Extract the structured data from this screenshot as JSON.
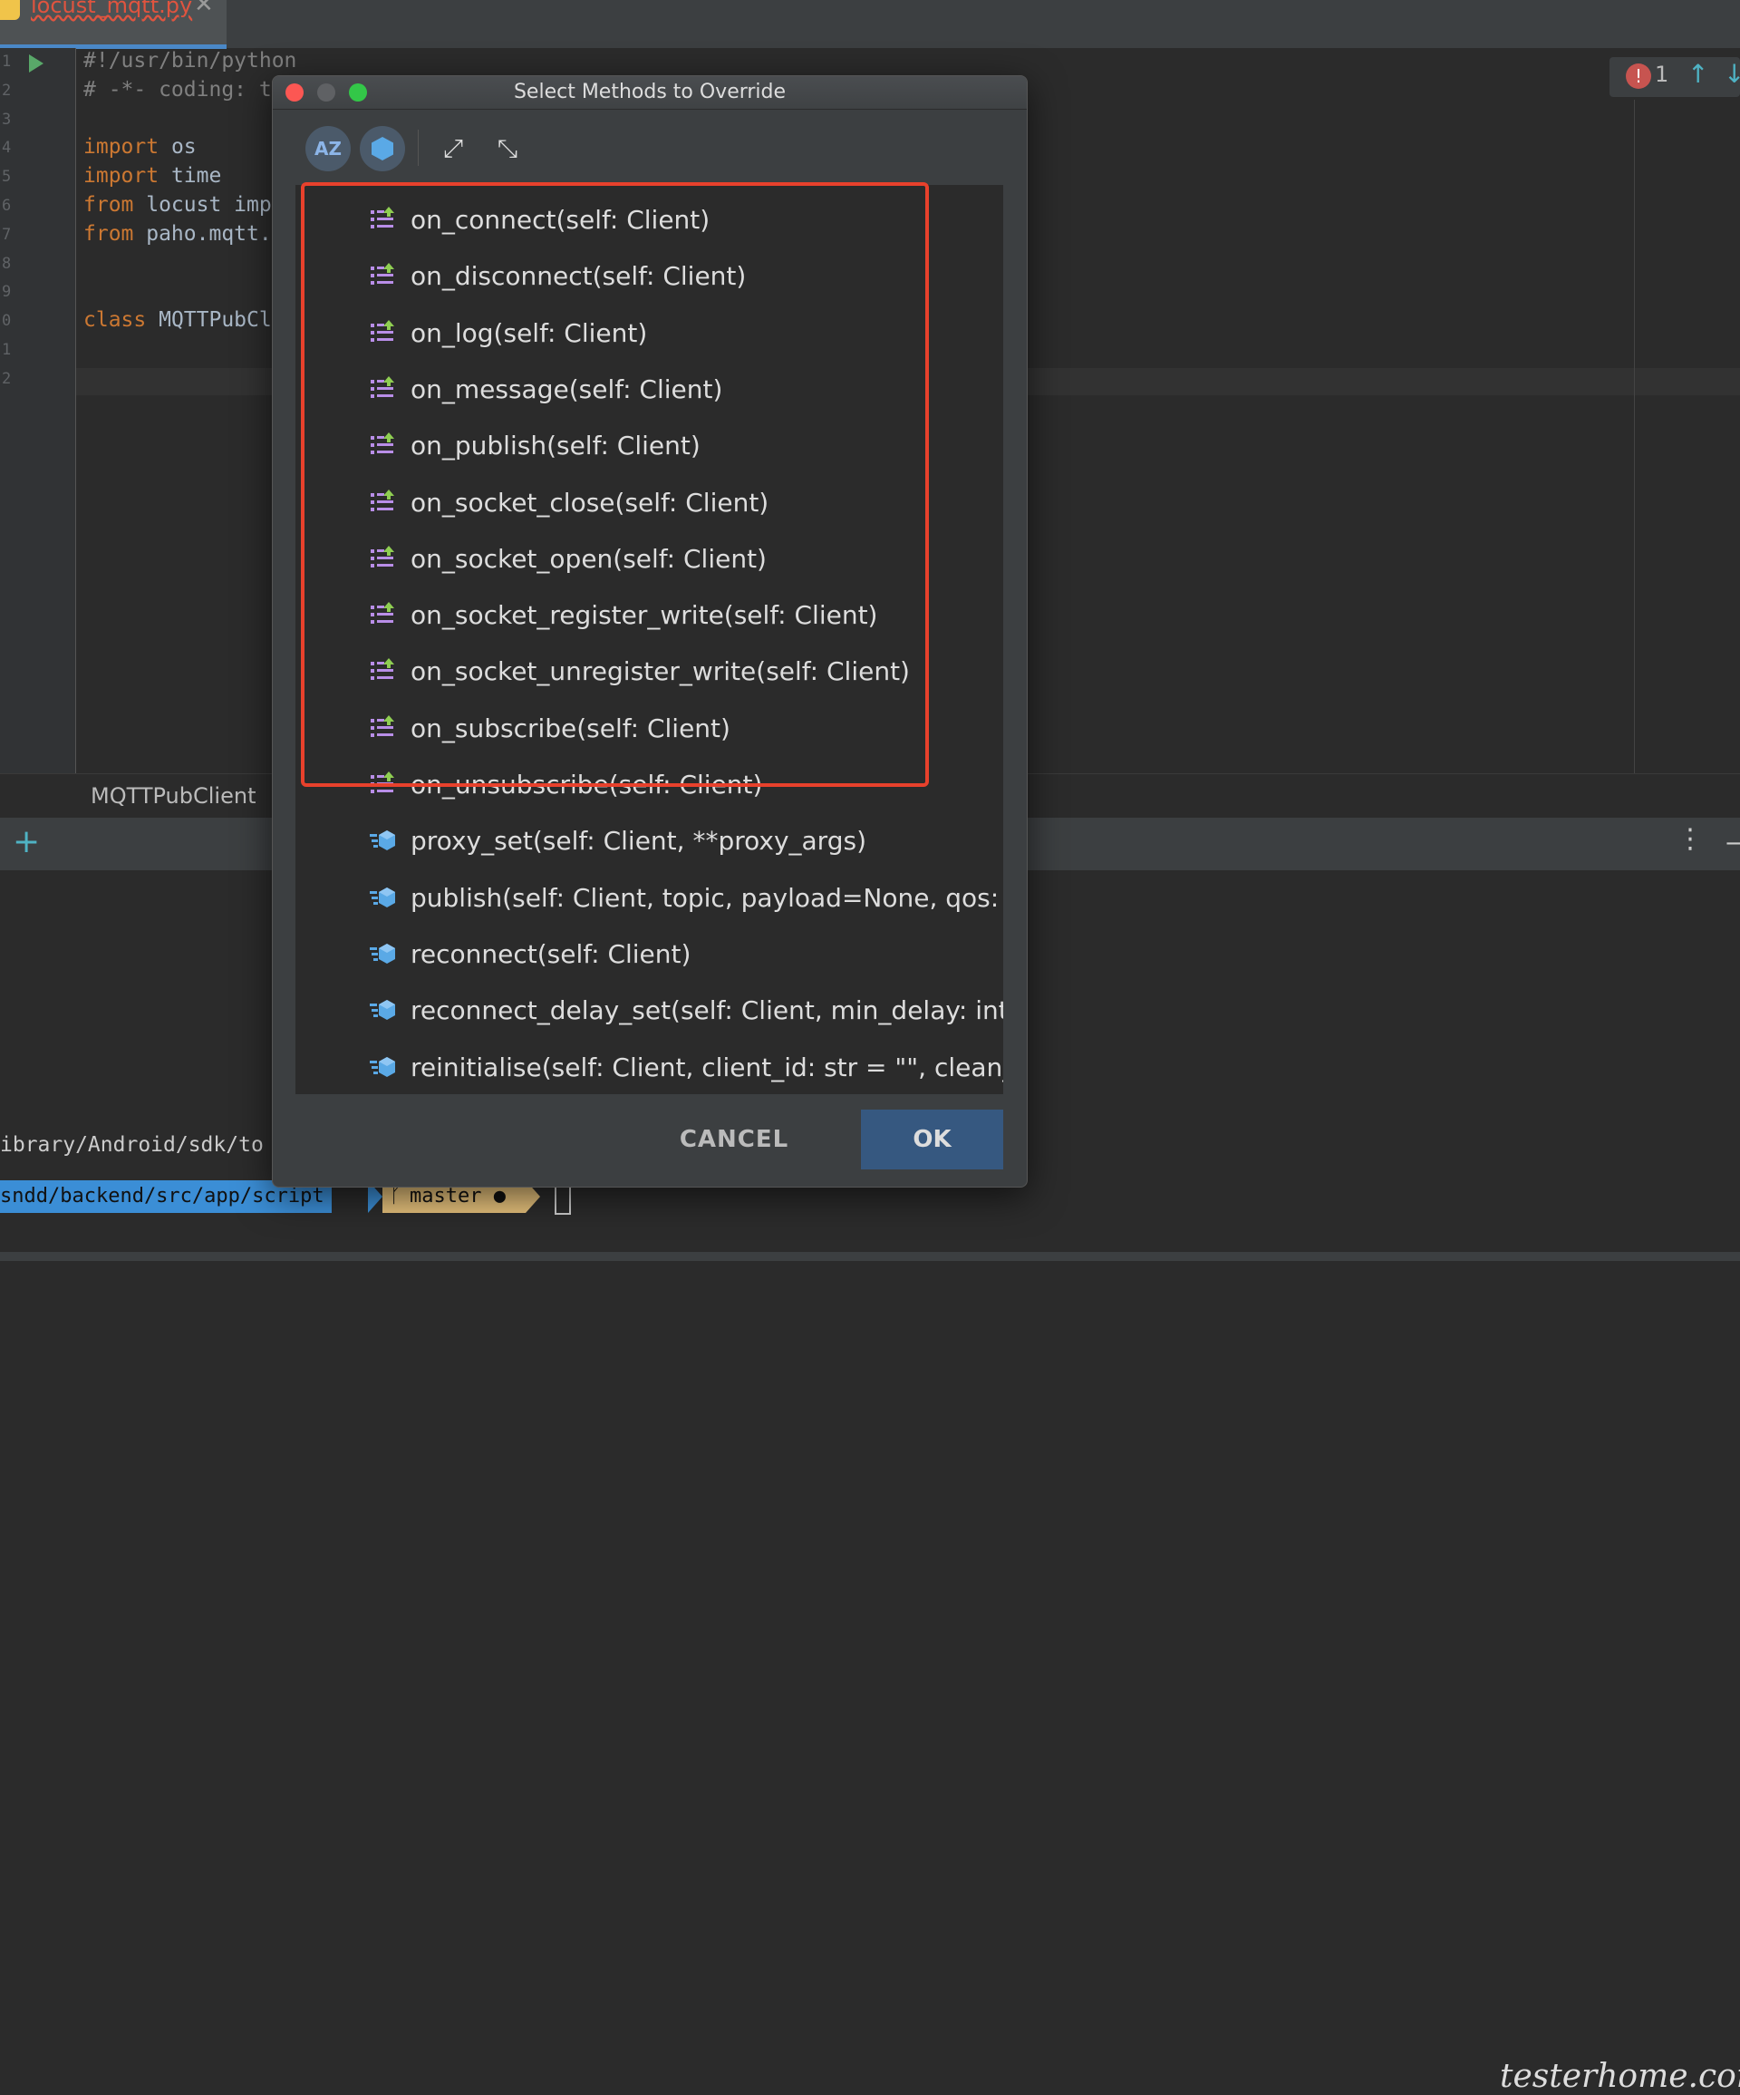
{
  "editor": {
    "tab": {
      "file_name": "locust_mqtt.py"
    },
    "line_numbers": [
      "1",
      "2",
      "3",
      "4",
      "5",
      "6",
      "7",
      "8",
      "9",
      "0",
      "1",
      "2"
    ],
    "code_lines": [
      {
        "kw": "",
        "rest": "#!/usr/bin/python",
        "comment": true
      },
      {
        "kw": "",
        "rest": "# -*- coding: t",
        "comment": true
      },
      {
        "kw": "",
        "rest": ""
      },
      {
        "kw": "import",
        "rest": " os"
      },
      {
        "kw": "import",
        "rest": " time"
      },
      {
        "kw": "from",
        "rest": " locust imp"
      },
      {
        "kw": "from",
        "rest": " paho.mqtt."
      },
      {
        "kw": "",
        "rest": ""
      },
      {
        "kw": "",
        "rest": ""
      },
      {
        "kw": "class",
        "rest": " MQTTPubCl"
      },
      {
        "kw": "",
        "rest": ""
      },
      {
        "kw": "",
        "rest": ""
      }
    ],
    "problems": {
      "count": "1"
    }
  },
  "breadcrumb": {
    "label": "MQTTPubClient"
  },
  "terminal": {
    "path_text": "ibrary/Android/sdk/to",
    "prompt_dir": "sndd/backend/src/app/script",
    "prompt_branch": "master ●"
  },
  "watermark": "testerhome.com",
  "dialog": {
    "title": "Select Methods to Override",
    "toolbar": {
      "sort_label": "AZ"
    },
    "methods": [
      {
        "label": "on_connect(self: Client)",
        "kind": "property"
      },
      {
        "label": "on_disconnect(self: Client)",
        "kind": "property"
      },
      {
        "label": "on_log(self: Client)",
        "kind": "property"
      },
      {
        "label": "on_message(self: Client)",
        "kind": "property"
      },
      {
        "label": "on_publish(self: Client)",
        "kind": "property"
      },
      {
        "label": "on_socket_close(self: Client)",
        "kind": "property"
      },
      {
        "label": "on_socket_open(self: Client)",
        "kind": "property"
      },
      {
        "label": "on_socket_register_write(self: Client)",
        "kind": "property"
      },
      {
        "label": "on_socket_unregister_write(self: Client)",
        "kind": "property"
      },
      {
        "label": "on_subscribe(self: Client)",
        "kind": "property"
      },
      {
        "label": "on_unsubscribe(self: Client)",
        "kind": "property"
      },
      {
        "label": "proxy_set(self: Client, **proxy_args)",
        "kind": "method"
      },
      {
        "label": "publish(self: Client, topic, payload=None, qos: int",
        "kind": "method"
      },
      {
        "label": "reconnect(self: Client)",
        "kind": "method"
      },
      {
        "label": "reconnect_delay_set(self: Client, min_delay: int =",
        "kind": "method"
      },
      {
        "label": "reinitialise(self: Client, client_id: str = \"\", clean_se",
        "kind": "method"
      }
    ],
    "cancel_label": "CANCEL",
    "ok_label": "OK"
  },
  "colors": {
    "accent": "#365880",
    "highlight_border": "#e8412c",
    "error": "#c75450",
    "keyword": "#cc7832"
  },
  "icons": {
    "property_item": "override-property-icon",
    "method_item": "override-method-icon"
  }
}
